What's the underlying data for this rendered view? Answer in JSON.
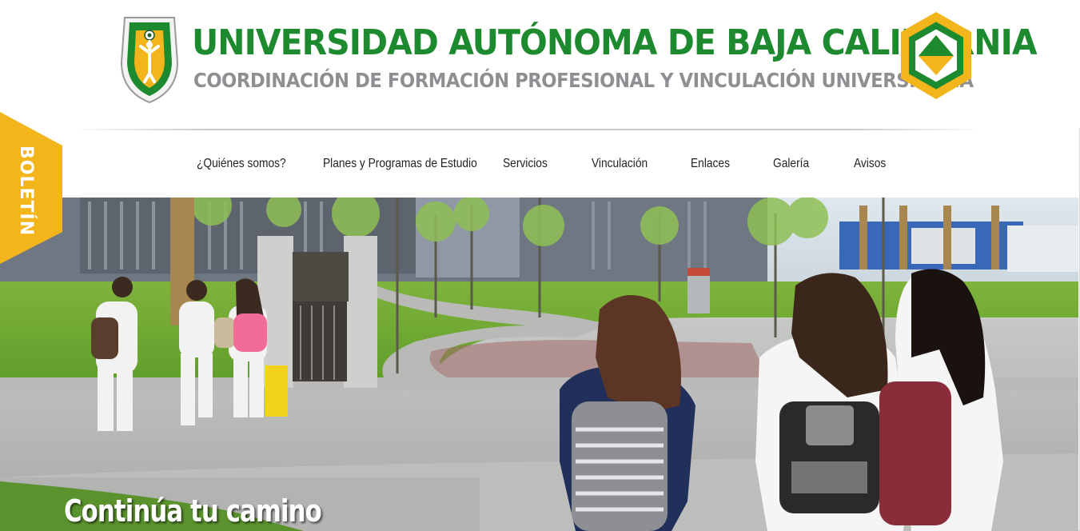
{
  "header": {
    "university_name": "UNIVERSIDAD AUTÓNOMA DE BAJA CALIFORNIA",
    "department_name": "COORDINACIÓN DE FORMACIÓN PROFESIONAL Y VINCULACIÓN UNIVERSITARIA",
    "brand_green": "#1e8a2f",
    "brand_gray": "#8f8f93",
    "brand_gold": "#f2b51c"
  },
  "nav": {
    "items": [
      {
        "label": "¿Quiénes somos?"
      },
      {
        "label": "Planes y Programas de Estudio"
      },
      {
        "label": "Servicios"
      },
      {
        "label": "Vinculación"
      },
      {
        "label": "Enlaces"
      },
      {
        "label": "Galería"
      },
      {
        "label": "Avisos"
      }
    ]
  },
  "boletin": {
    "label": "BOLETÍN",
    "color": "#f2b51c"
  },
  "hero": {
    "caption": "Continúa tu camino",
    "image_icon": "campus-photo"
  }
}
